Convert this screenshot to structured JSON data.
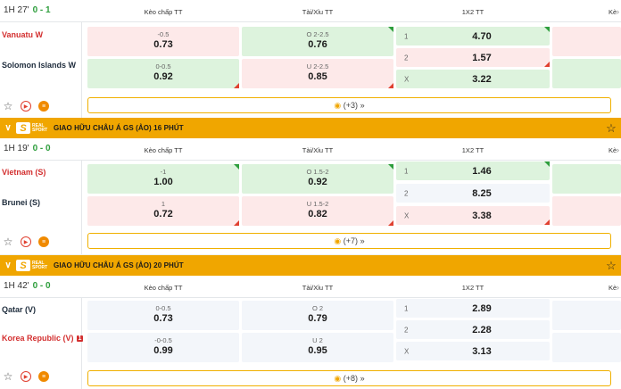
{
  "headers": {
    "handicap": "Kèo chấp TT",
    "overunder": "Tài/Xỉu TT",
    "onextwo": "1X2 TT",
    "extra": "Kè"
  },
  "leagues": [
    {
      "title": "GIAO HỮU CHÂU Á GS (ẢO) 16 PHÚT"
    },
    {
      "title": "GIAO HỮU CHÂU Á GS (ẢO) 20 PHÚT"
    }
  ],
  "logo": {
    "letter": "S",
    "text": "REAL SPORT"
  },
  "matches": [
    {
      "time": "1H 27'",
      "score": "0 - 1",
      "home": "Vanuatu W",
      "away": "Solomon Islands W",
      "hdp": [
        {
          "line": "-0.5",
          "odd": "0.73"
        },
        {
          "line": "0-0.5",
          "odd": "0.92"
        }
      ],
      "ou": [
        {
          "line": "O 2-2.5",
          "odd": "0.76"
        },
        {
          "line": "U 2-2.5",
          "odd": "0.85"
        }
      ],
      "x12": [
        {
          "lbl": "1",
          "odd": "4.70"
        },
        {
          "lbl": "2",
          "odd": "1.57"
        },
        {
          "lbl": "X",
          "odd": "3.22"
        }
      ],
      "more": "(+3)"
    },
    {
      "time": "1H 19'",
      "score": "0 - 0",
      "home": "Vietnam (S)",
      "away": "Brunei (S)",
      "hdp": [
        {
          "line": "-1",
          "odd": "1.00"
        },
        {
          "line": "1",
          "odd": "0.72"
        }
      ],
      "ou": [
        {
          "line": "O 1.5-2",
          "odd": "0.92"
        },
        {
          "line": "U 1.5-2",
          "odd": "0.82"
        }
      ],
      "x12": [
        {
          "lbl": "1",
          "odd": "1.46"
        },
        {
          "lbl": "2",
          "odd": "8.25"
        },
        {
          "lbl": "X",
          "odd": "3.38"
        }
      ],
      "more": "(+7)"
    },
    {
      "time": "1H 42'",
      "score": "0 - 0",
      "home": "Qatar (V)",
      "away": "Korea Republic (V)",
      "away_card": "1",
      "hdp": [
        {
          "line": "0-0.5",
          "odd": "0.73"
        },
        {
          "line": "-0-0.5",
          "odd": "0.99"
        }
      ],
      "ou": [
        {
          "line": "O 2",
          "odd": "0.79"
        },
        {
          "line": "U 2",
          "odd": "0.95"
        }
      ],
      "x12": [
        {
          "lbl": "1",
          "odd": "2.89"
        },
        {
          "lbl": "2",
          "odd": "2.28"
        },
        {
          "lbl": "X",
          "odd": "3.13"
        }
      ],
      "more": "(+8)"
    }
  ],
  "icons": {
    "favorite": "star-icon",
    "live": "play-icon",
    "stats": "stats-icon",
    "more": "soccer-ball-icon",
    "expand": "chevron-down-icon"
  }
}
